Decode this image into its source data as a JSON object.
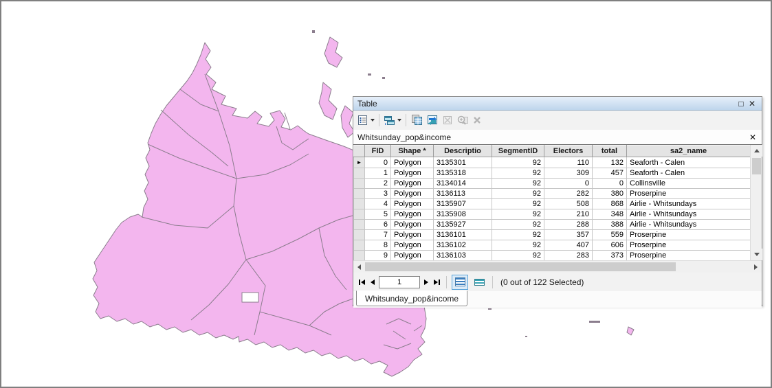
{
  "window": {
    "title": "Table"
  },
  "icons": {
    "maximize": "□",
    "close": "✕",
    "close_tab": "✕",
    "current_record": "►"
  },
  "toolbar": {
    "items": [
      "table-options",
      "related-tables",
      "select-by-attributes",
      "switch-selection",
      "clear-selection",
      "zoom-to-selected",
      "delete-selected"
    ]
  },
  "document_bar": {
    "title": "Whitsunday_pop&income"
  },
  "table": {
    "columns": [
      {
        "key": "fid",
        "label": "FID",
        "align": "r"
      },
      {
        "key": "shape",
        "label": "Shape *",
        "align": "l"
      },
      {
        "key": "descriptio",
        "label": "Descriptio",
        "align": "l"
      },
      {
        "key": "segmentid",
        "label": "SegmentID",
        "align": "r"
      },
      {
        "key": "electors",
        "label": "Electors",
        "align": "r"
      },
      {
        "key": "total",
        "label": "total",
        "align": "r"
      },
      {
        "key": "sa2_name",
        "label": "sa2_name",
        "align": "l"
      }
    ],
    "active_row_index": 0,
    "rows": [
      {
        "fid": "0",
        "shape": "Polygon",
        "descriptio": "3135301",
        "segmentid": "92",
        "electors": "110",
        "total": "132",
        "sa2_name": "Seaforth - Calen"
      },
      {
        "fid": "1",
        "shape": "Polygon",
        "descriptio": "3135318",
        "segmentid": "92",
        "electors": "309",
        "total": "457",
        "sa2_name": "Seaforth - Calen"
      },
      {
        "fid": "2",
        "shape": "Polygon",
        "descriptio": "3134014",
        "segmentid": "92",
        "electors": "0",
        "total": "0",
        "sa2_name": "Collinsville"
      },
      {
        "fid": "3",
        "shape": "Polygon",
        "descriptio": "3136113",
        "segmentid": "92",
        "electors": "282",
        "total": "380",
        "sa2_name": "Proserpine"
      },
      {
        "fid": "4",
        "shape": "Polygon",
        "descriptio": "3135907",
        "segmentid": "92",
        "electors": "508",
        "total": "868",
        "sa2_name": "Airlie - Whitsundays"
      },
      {
        "fid": "5",
        "shape": "Polygon",
        "descriptio": "3135908",
        "segmentid": "92",
        "electors": "210",
        "total": "348",
        "sa2_name": "Airlie - Whitsundays"
      },
      {
        "fid": "6",
        "shape": "Polygon",
        "descriptio": "3135927",
        "segmentid": "92",
        "electors": "288",
        "total": "388",
        "sa2_name": "Airlie - Whitsundays"
      },
      {
        "fid": "7",
        "shape": "Polygon",
        "descriptio": "3136101",
        "segmentid": "92",
        "electors": "357",
        "total": "559",
        "sa2_name": "Proserpine"
      },
      {
        "fid": "8",
        "shape": "Polygon",
        "descriptio": "3136102",
        "segmentid": "92",
        "electors": "407",
        "total": "606",
        "sa2_name": "Proserpine"
      },
      {
        "fid": "9",
        "shape": "Polygon",
        "descriptio": "3136103",
        "segmentid": "92",
        "electors": "283",
        "total": "373",
        "sa2_name": "Proserpine"
      }
    ]
  },
  "record_navigation": {
    "current_record_value": "1",
    "status": "(0 out of 122 Selected)"
  },
  "bottom_tab": {
    "label": "Whitsunday_pop&income"
  },
  "map": {
    "region_fill": "#f3b6ee",
    "region_stroke": "#8b7d8d",
    "sea": "#ffffff"
  },
  "colors": {
    "titlebar_top": "#e7f0fa",
    "titlebar_bottom": "#bed5ec",
    "window_bg": "#f2f2f2",
    "grid_line": "#c6c6c6",
    "header_bg": "#e4e4e4",
    "selection_accent": "#59a2d8",
    "map_fill": "#f3b6ee",
    "map_stroke": "#8b7d8d"
  }
}
